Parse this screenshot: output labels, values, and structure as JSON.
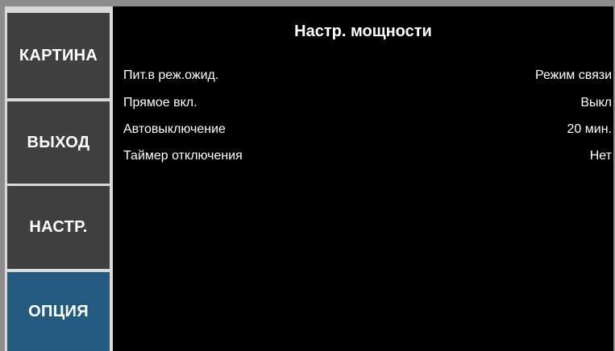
{
  "sidebar": {
    "tabs": [
      {
        "label": "КАРТИНА"
      },
      {
        "label": "ВЫХОД"
      },
      {
        "label": "НАСТР."
      },
      {
        "label": "ОПЦИЯ"
      }
    ],
    "active_tab": "ОПЦИЯ"
  },
  "panel": {
    "title": "Настр. мощности",
    "settings": [
      {
        "label": "Пит.в реж.ожид.",
        "value": "Режим связи"
      },
      {
        "label": "Прямое вкл.",
        "value": "Выкл"
      },
      {
        "label": "Автовыключение",
        "value": "20 мин."
      },
      {
        "label": "Таймер отключения",
        "value": "Нет"
      }
    ]
  },
  "colors": {
    "tab_background": "#404040",
    "active_tab_background": "#245a7f",
    "content_background": "#000000",
    "text": "#ffffff"
  }
}
